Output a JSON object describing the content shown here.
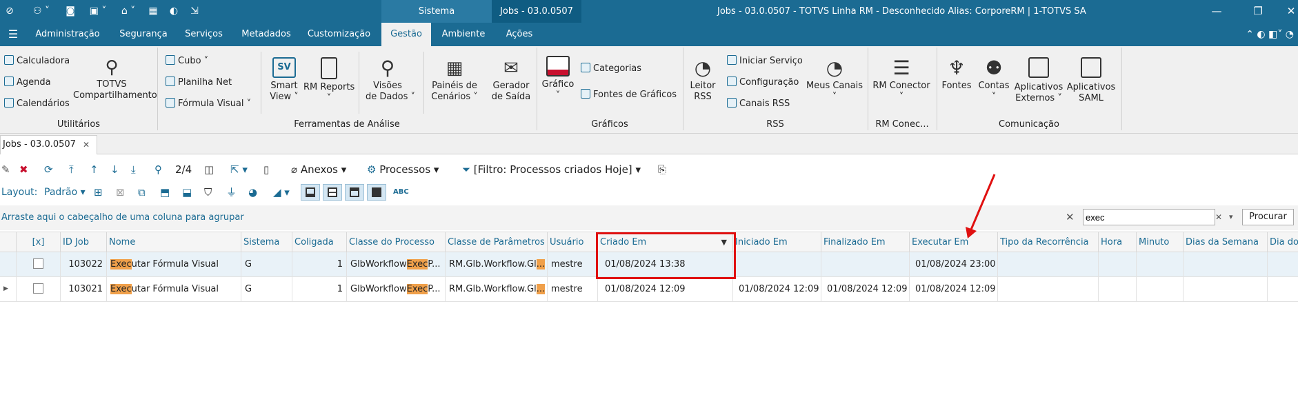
{
  "window": {
    "tab_sistema": "Sistema",
    "tab_jobs": "Jobs - 03.0.0507",
    "title": "Jobs - 03.0.0507 - TOTVS Linha RM - Desconhecido  Alias: CorporeRM | 1-TOTVS SA"
  },
  "menu": [
    "Administração",
    "Segurança",
    "Serviços",
    "Metadados",
    "Customização",
    "Gestão",
    "Ambiente",
    "Ações"
  ],
  "menu_active": "Gestão",
  "ribbon": {
    "utilitarios": {
      "calculadora": "Calculadora",
      "agenda": "Agenda",
      "calendarios": "Calendários",
      "totvs1": "TOTVS",
      "totvs2": "Compartilhamento",
      "group": "Utilitários"
    },
    "analise": {
      "cubo": "Cubo",
      "planilha": "Planilha Net",
      "formula": "Fórmula Visual",
      "smart1": "Smart",
      "smart2": "View",
      "rmreports": "RM Reports",
      "visoes1": "Visões",
      "visoes2": "de Dados",
      "paineis1": "Painéis de",
      "paineis2": "Cenários",
      "gerador1": "Gerador",
      "gerador2": "de Saída",
      "group": "Ferramentas de Análise"
    },
    "graficos": {
      "grafico": "Gráfico",
      "categorias": "Categorias",
      "fontes": "Fontes de Gráficos",
      "group": "Gráficos"
    },
    "rss": {
      "leitor1": "Leitor",
      "leitor2": "RSS",
      "iniciar": "Iniciar Serviço",
      "config": "Configuração",
      "canais": "Canais RSS",
      "meus": "Meus Canais",
      "group": "RSS"
    },
    "rmcon": {
      "label": "RM Conector",
      "group": "RM Conec..."
    },
    "comunicacao": {
      "fontes": "Fontes",
      "contas": "Contas",
      "apl1": "Aplicativos",
      "apl2": "Externos",
      "saml1": "Aplicativos",
      "saml2": "SAML",
      "group": "Comunicação"
    }
  },
  "doc_tab": "Jobs - 03.0.0507",
  "toolbar": {
    "page": "2/4",
    "anexos": "Anexos",
    "processos": "Processos",
    "filtro": "[Filtro: Processos criados Hoje]",
    "layout_label": "Layout:",
    "layout_value": "Padrão"
  },
  "groupbar": {
    "hint": "Arraste aqui o cabeçalho de uma coluna para agrupar",
    "search_value": "exec",
    "search_button": "Procurar"
  },
  "columns": [
    "[x]",
    "ID Job",
    "Nome",
    "Sistema",
    "Coligada",
    "Classe do Processo",
    "Classe de Parâmetros",
    "Usuário",
    "Criado Em",
    "Iniciado Em",
    "Finalizado Em",
    "Executar Em",
    "Tipo da Recorrência",
    "Hora",
    "Minuto",
    "Dias da Semana",
    "Dia do"
  ],
  "rows": [
    {
      "id": "103022",
      "nome_hl": "Exec",
      "nome_rest": "utar Fórmula Visual",
      "sistema": "G",
      "coligada": "1",
      "cp_pre": "GlbWorkflow",
      "cp_hl": "Exec",
      "cp_post": "P...",
      "cparam": "RM.Glb.Workflow.Gl",
      "cparam_hl": "...",
      "usuario": "mestre",
      "criado": "01/08/2024 13:38",
      "iniciado": "",
      "finalizado": "",
      "executar": "01/08/2024 23:00"
    },
    {
      "id": "103021",
      "nome_hl": "Exec",
      "nome_rest": "utar Fórmula Visual",
      "sistema": "G",
      "coligada": "1",
      "cp_pre": "GlbWorkflow",
      "cp_hl": "Exec",
      "cp_post": "P...",
      "cparam": "RM.Glb.Workflow.Gl",
      "cparam_hl": "...",
      "usuario": "mestre",
      "criado": "01/08/2024 12:09",
      "iniciado": "01/08/2024 12:09",
      "finalizado": "01/08/2024 12:09",
      "executar": "01/08/2024 12:09"
    }
  ],
  "annotation_color": "#e01010"
}
